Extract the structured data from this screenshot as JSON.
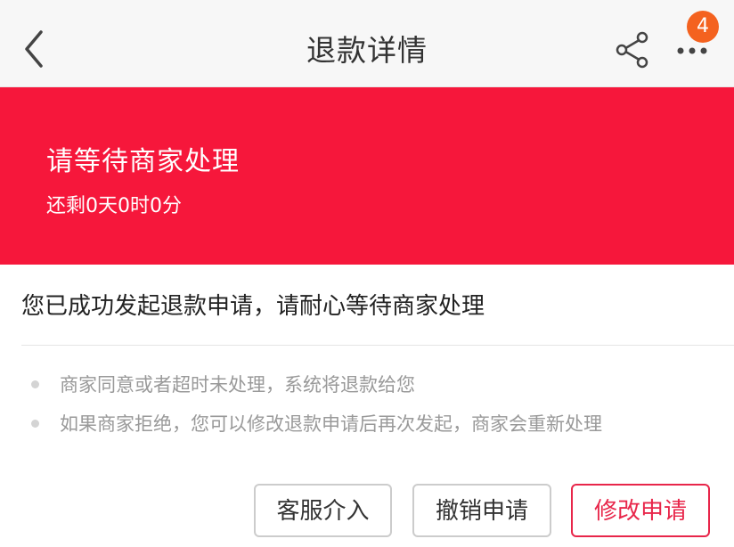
{
  "header": {
    "title": "退款详情",
    "badge_count": "4"
  },
  "banner": {
    "title": "请等待商家处理",
    "countdown": "还剩0天0时0分",
    "background_color": "#f6173b"
  },
  "message": "您已成功发起退款申请，请耐心等待商家处理",
  "notes": [
    "商家同意或者超时未处理，系统将退款给您",
    "如果商家拒绝，您可以修改退款申请后再次发起，商家会重新处理"
  ],
  "actions": {
    "service": "客服介入",
    "cancel": "撤销申请",
    "modify": "修改申请"
  },
  "colors": {
    "accent": "#e8264a",
    "badge": "#f4621f"
  },
  "icons": {
    "back": "chevron-left-icon",
    "share": "share-icon",
    "more": "more-dots-icon"
  }
}
